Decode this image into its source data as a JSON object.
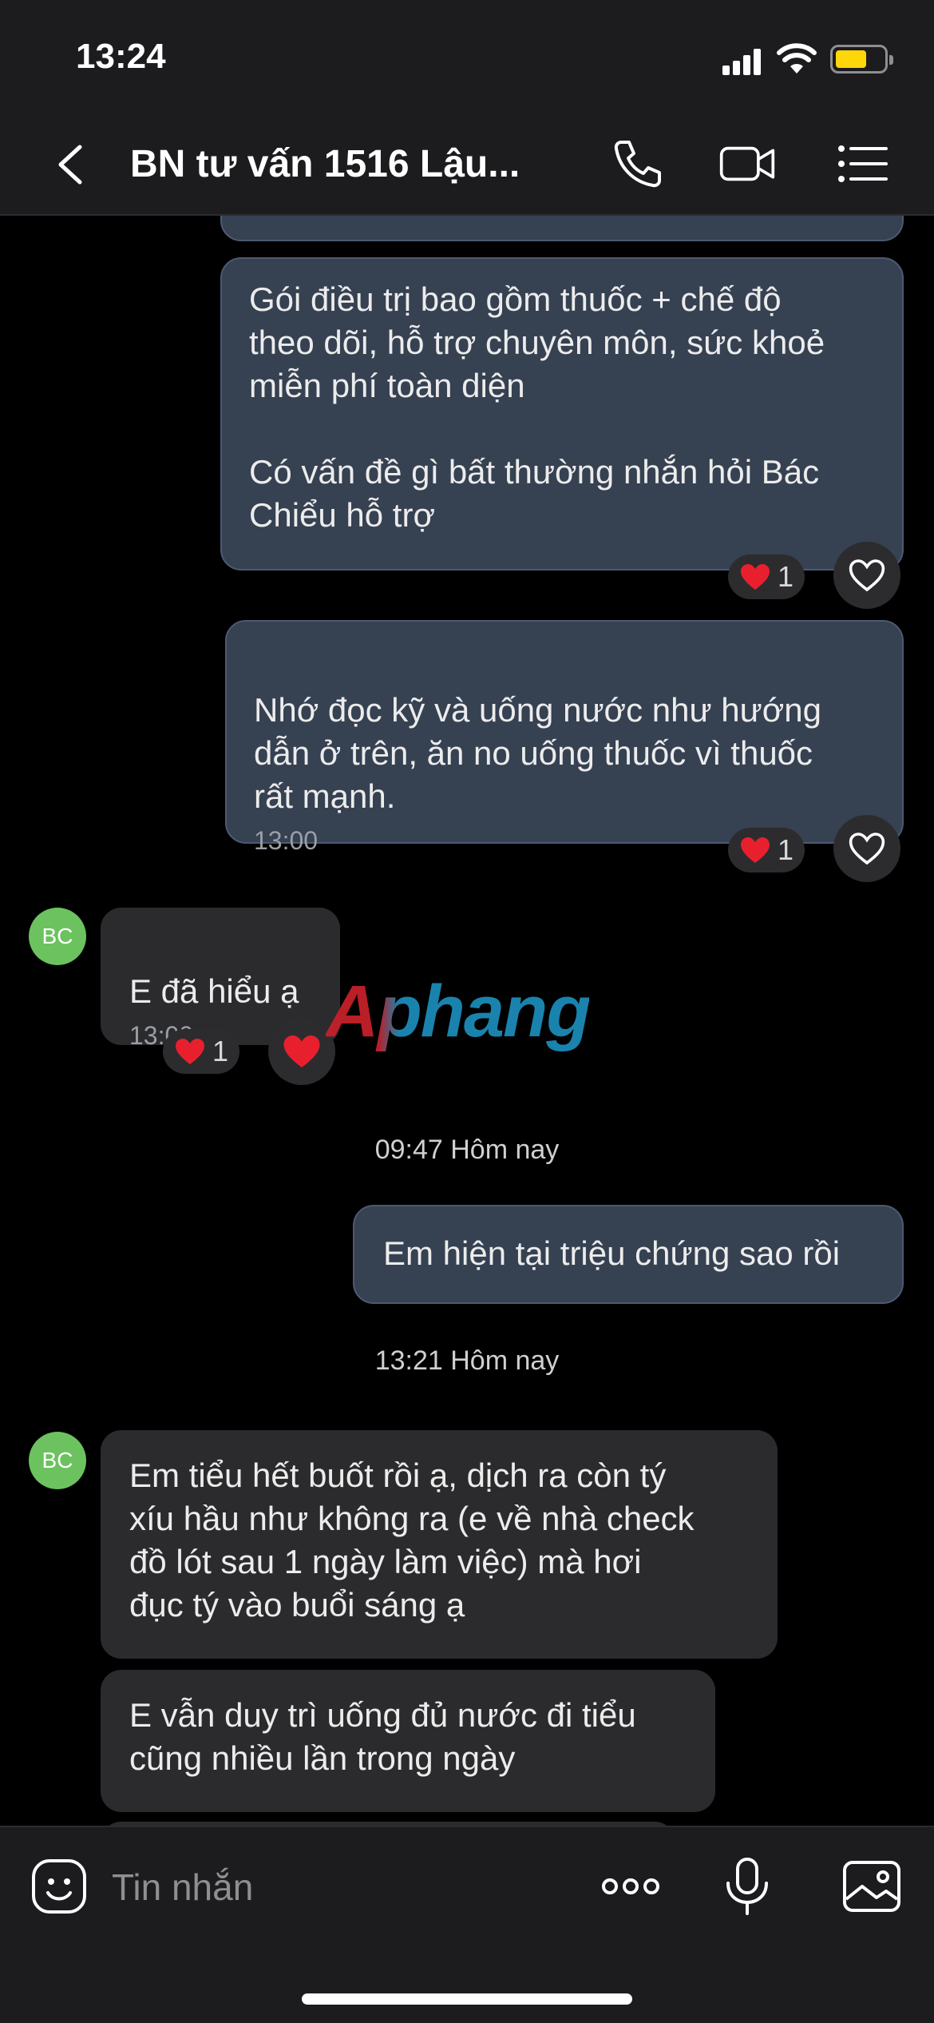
{
  "status_bar": {
    "time": "13:24"
  },
  "header": {
    "title": "BN tư vấn 1516 Lậu..."
  },
  "messages": [
    {
      "text": "Gói điều trị bao gồm thuốc + chế độ\ntheo dõi, hỗ trợ chuyên môn, sức khoẻ\nmiễn phí toàn diện\n\nCó vấn đề gì bất thường nhắn hỏi Bác\nChiểu hỗ trợ",
      "reaction_count": "1"
    },
    {
      "text": "Nhớ đọc kỹ và uống nước như hướng\ndẫn ở trên, ăn no uống thuốc vì thuốc\nrất mạnh.",
      "time": "13:00",
      "reaction_count": "1"
    },
    {
      "avatar": "BC",
      "text": "E đã hiểu ạ",
      "time": "13:00",
      "reaction_count": "1"
    },
    {
      "text": "Em hiện tại triệu chứng sao rồi"
    },
    {
      "avatar": "BC",
      "text": "Em tiểu hết buốt rồi ạ, dịch ra còn tý\nxíu hầu như không ra (e về nhà check\nđồ lót sau 1 ngày làm việc)  mà hơi\nđục tý vào buổi sáng ạ"
    },
    {
      "text": "E vẫn duy trì uống đủ nước đi tiểu\ncũng nhiều lần trong ngày"
    }
  ],
  "separators": [
    "09:47 Hôm nay",
    "13:21 Hôm nay"
  ],
  "watermark": "Aphang",
  "input": {
    "placeholder": "Tin nhắn"
  },
  "colors": {
    "outgoing_bubble": "#364152",
    "incoming_bubble": "#2b2b2d",
    "avatar": "#6cc25f",
    "heart": "#e8202e",
    "battery": "#ffd60a"
  }
}
